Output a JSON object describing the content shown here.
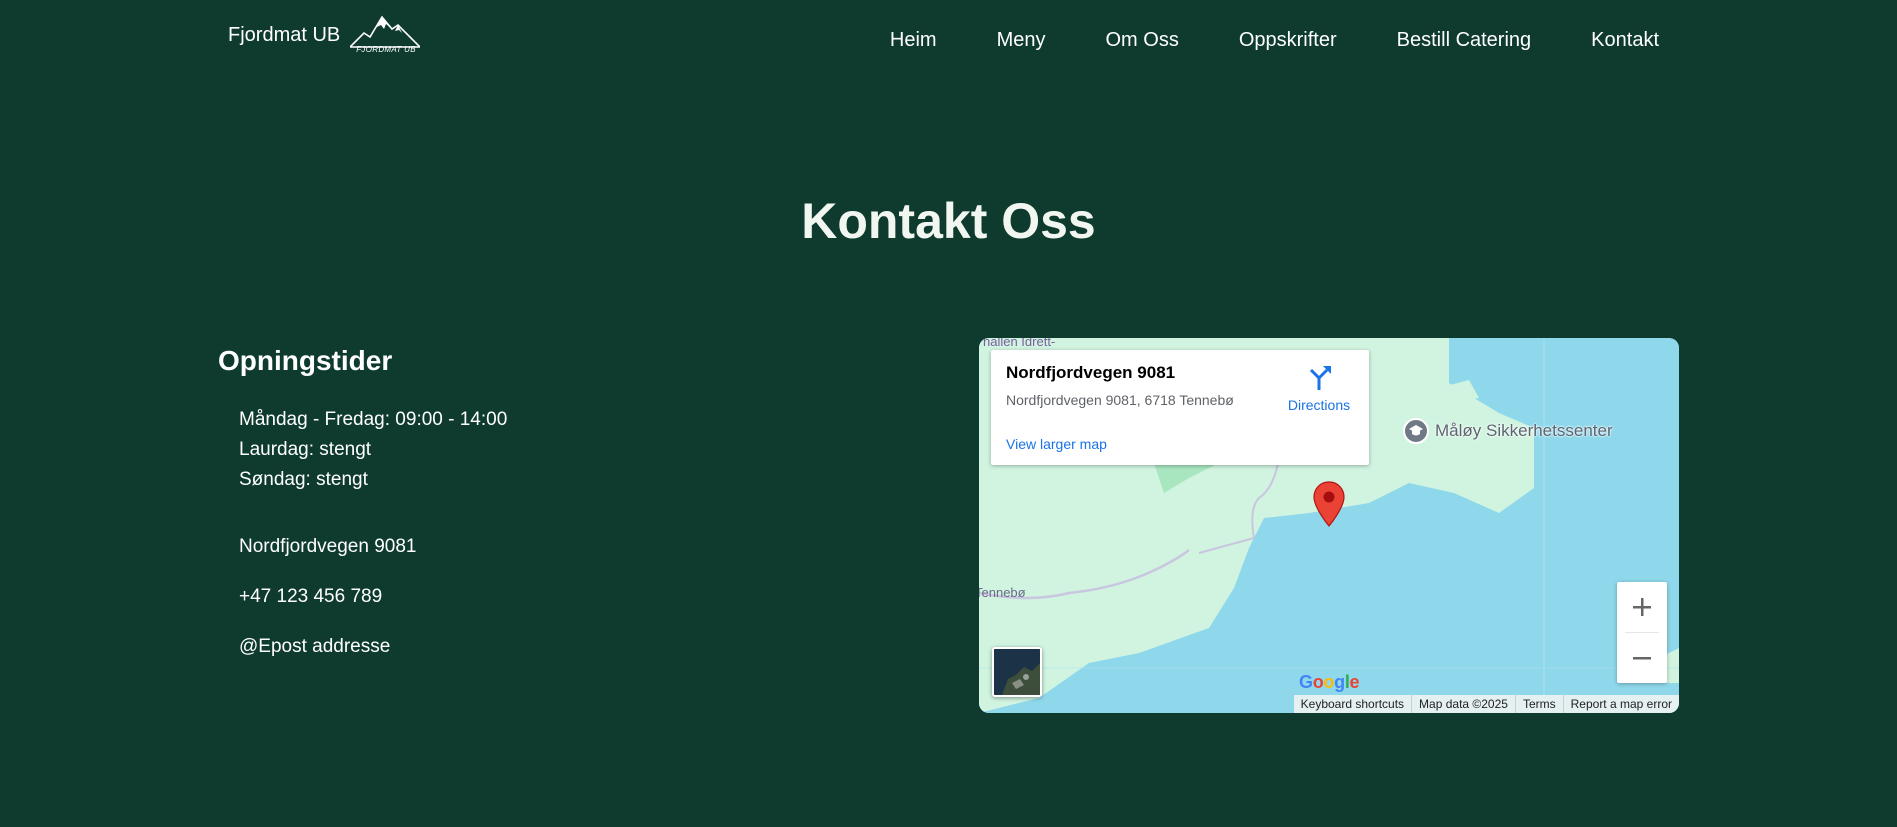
{
  "header": {
    "brand_name": "Fjordmat UB",
    "logo_text": "FJORDMAT UB",
    "nav": [
      "Heim",
      "Meny",
      "Om Oss",
      "Oppskrifter",
      "Bestill Catering",
      "Kontakt"
    ]
  },
  "main": {
    "title": "Kontakt Oss",
    "hours_heading": "Opningstider",
    "hours": [
      "Måndag - Fredag: 09:00 - 14:00",
      "Laurdag: stengt",
      "Søndag: stengt"
    ],
    "address": "Nordfjordvegen 9081",
    "phone": "+47 123 456 789",
    "email": "@Epost addresse"
  },
  "map": {
    "place_title": "Nordfjordvegen 9081",
    "place_address": "Nordfjordvegen 9081, 6718 Tennebø",
    "directions_label": "Directions",
    "view_larger": "View larger map",
    "poi_label": "Måløy Sikkerhetssenter",
    "road_label": "Tennebø",
    "top_label": "hallen Idrett-",
    "google_logo": "Google",
    "attribution": [
      "Keyboard shortcuts",
      "Map data ©2025",
      "Terms",
      "Report a map error"
    ]
  },
  "colors": {
    "background": "#0e3b2e",
    "water": "#8fd8ec",
    "land": "#d1f4e0",
    "link_blue": "#1a73e8",
    "pin_red": "#ea4335"
  }
}
